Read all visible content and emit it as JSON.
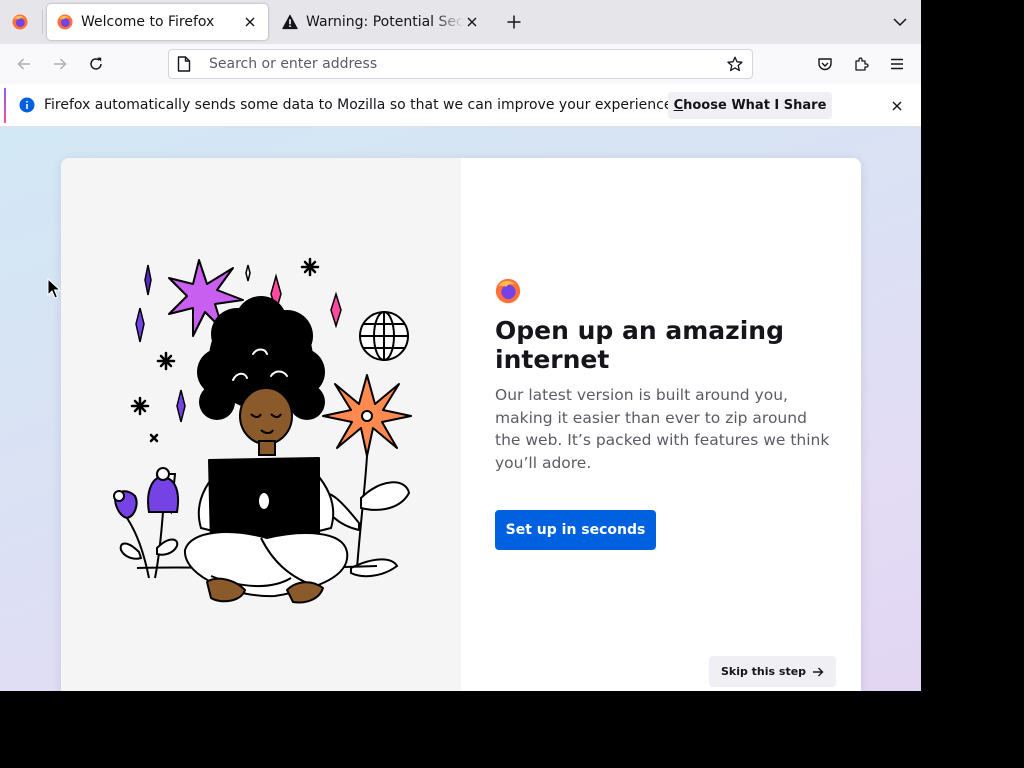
{
  "tabs": [
    {
      "title": "Welcome to Firefox",
      "icon": "firefox-logo-icon",
      "active": true
    },
    {
      "title": "Warning: Potential Security Risk Ahead",
      "icon": "warning-icon",
      "active": false
    }
  ],
  "toolbar": {
    "back": "back-arrow-icon",
    "forward": "forward-arrow-icon",
    "reload": "reload-icon",
    "pocket": "pocket-icon",
    "extensions": "extensions-icon",
    "menu": "hamburger-menu-icon"
  },
  "urlbar": {
    "placeholder": "Search or enter address",
    "value": ""
  },
  "notification": {
    "text": "Firefox automatically sends some data to Mozilla so that we can improve your experience.",
    "action_access_key": "C",
    "action_rest": "hoose What I Share",
    "accent_colors": [
      "#9059ff",
      "#ff4aa2"
    ]
  },
  "welcome": {
    "title": "Open up an amazing internet",
    "description": "Our latest version is built around you, making it easier than ever to zip around the web. It’s packed with features we think you’ll adore.",
    "primary_button": "Set up in seconds",
    "skip_button": "Skip this step",
    "primary_color": "#0061e0"
  }
}
